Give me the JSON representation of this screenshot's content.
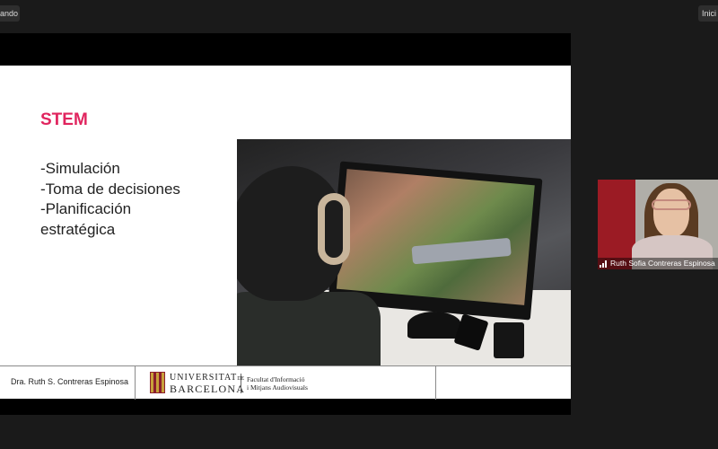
{
  "top_bar": {
    "left_label": "ando",
    "right_label": "Inici"
  },
  "slide": {
    "title": "STEM",
    "bullets": [
      "-Simulación",
      "-Toma de decisiones",
      "-Planificación",
      "estratégica"
    ],
    "footer": {
      "author": "Dra. Ruth S. Contreras Espinosa",
      "university_line1": "UNIVERSITAT",
      "university_line1_suffix": "DE",
      "university_line2": "BARCELONA",
      "faculty_line1": "Facultat d'Informació",
      "faculty_line2": "i Mitjans Audiovisuals"
    }
  },
  "participant": {
    "name": "Ruth Sofia Contreras Espinosa"
  },
  "colors": {
    "title_accent": "#e0245e",
    "background": "#1a1a1a"
  }
}
